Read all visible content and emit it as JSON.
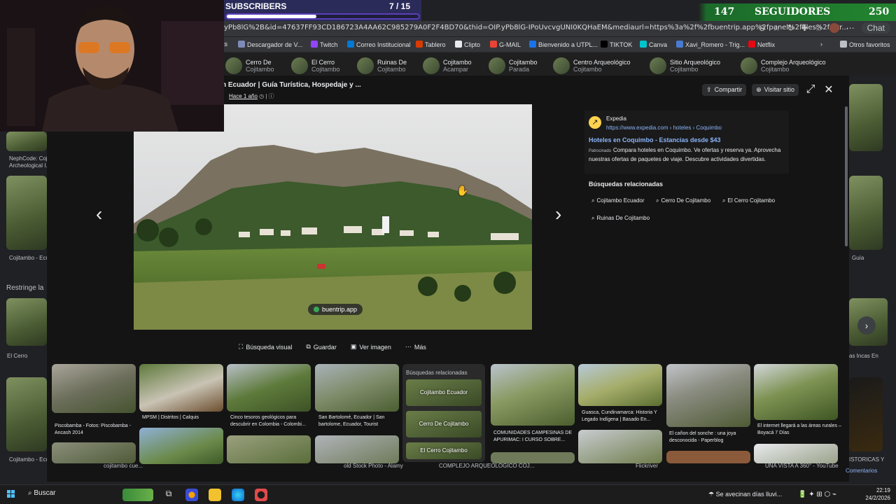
{
  "overlay": {
    "subscribers": {
      "label": "SUBSCRIBERS",
      "count": "7 / 15",
      "progress": 0.4667
    },
    "followers": {
      "current": "147",
      "label": "SEGUIDORES",
      "goal": "250"
    }
  },
  "browser": {
    "url": "yPb8lG%2B&id=47637FF93CD186723A4AA62C985279A0F2F4BD70&thid=OIP.yPb8lG-IPoUvcvgUNI0KQHaEM&mediaurl=https%3a%2f%2fbuentrip.app%2fpanel%2ffiles%2fattr...",
    "chat_label": "Chat",
    "bookmarks": [
      "ts",
      "Descargador de V...",
      "Twitch",
      "Correo Institucional",
      "Tablero",
      "Clipto",
      "G-MAIL",
      "Bienvenido a UTPL...",
      "TIKTOK",
      "Canva",
      "Xavi_Romero - Trig...",
      "Netflix"
    ],
    "other_favorites": "Otros favoritos"
  },
  "related_chips": [
    {
      "title": "Cerro De",
      "sub": "Cojitambo"
    },
    {
      "title": "El Cerro",
      "sub": "Cojitambo"
    },
    {
      "title": "Ruinas De",
      "sub": "Cojitambo"
    },
    {
      "title": "Cojitambo",
      "sub": "Acampar"
    },
    {
      "title": "Cojitambo",
      "sub": "Parada"
    },
    {
      "title": "Centro Arqueológico",
      "sub": "Cojitambo"
    },
    {
      "title": "Sitio Arqueológico",
      "sub": "Cojitambo"
    },
    {
      "title": "Complejo Arqueológico",
      "sub": "Cojitambo"
    }
  ],
  "background_page": {
    "left_captions": [
      "NephCode: Coj...",
      "Archeological I...",
      "Cojitambo - Ecu...",
      "Restringe la",
      "El Cerro",
      "Cojitambo - Ecu..."
    ],
    "right_captions": [
      "Guía",
      "as Incas En",
      "ISTORICAS Y"
    ],
    "bottom_captions": [
      "cojitambo cue...",
      "old Stock Photo - Alamy",
      "COMPLEJO ARQUEOLOGICO COJ...",
      "Flickriver",
      "UNA VISTA A 360° - YouTube"
    ],
    "comments": "Comentarios"
  },
  "viewer": {
    "title": "n Ecuador | Guía Turística, Hospedaje y ...",
    "age": "Hace 1 año",
    "share_label": "Compartir",
    "visit_label": "Visitar sitio",
    "source_badge": "buentrip.app",
    "actions": [
      "Búsqueda visual",
      "Guardar",
      "Ver imagen",
      "Más"
    ],
    "sponsored": {
      "advertiser": "Expedia",
      "url": "https://www.expedia.com › hoteles › Coquimbo",
      "headline": "Hoteles en Coquimbo - Estancias desde $43",
      "tag": "Patrocinado",
      "body": "Compara hoteles en Coquimbo. Ve ofertas y reserva ya. Aprovecha nuestras ofertas de paquetes de viaje. Descubre actividades divertidas."
    },
    "related_title": "Búsquedas relacionadas",
    "related": [
      "Cojitambo Ecuador",
      "Cerro De Cojitambo",
      "El Cerro Cojitambo",
      "Ruinas De Cojitambo"
    ]
  },
  "grid": {
    "captions": [
      "Piscobamba - Fotos: Piscobamba - Ancash 2014",
      "MPSM | Distritos | Calquis",
      "Cinco tesoros geológicos para descubrir en Colombia - Colombi...",
      "San Bartolomé, Ecuador | San bartolome, Ecuador, Tourist",
      "COMUNIDADES CAMPESINAS DE APURIMAC: I CURSO SOBRE...",
      "Guasca, Cundinamarca: Historia Y Legado Indígena | Basado En...",
      "El cañon del sonche : una joya desconocida - Paperblog",
      "El internet llegará a las áreas rurales – Boyacá 7 Días"
    ],
    "related_box_title": "Búsquedas relacionadas",
    "related_box_items": [
      "Cojitambo Ecuador",
      "Cerro De Cojitambo",
      "El Cerro Cojitambo"
    ]
  },
  "taskbar": {
    "search": "Buscar",
    "weather": "Se avecinan días lluvi...",
    "time": "22:19",
    "date": "24/2/2026"
  }
}
